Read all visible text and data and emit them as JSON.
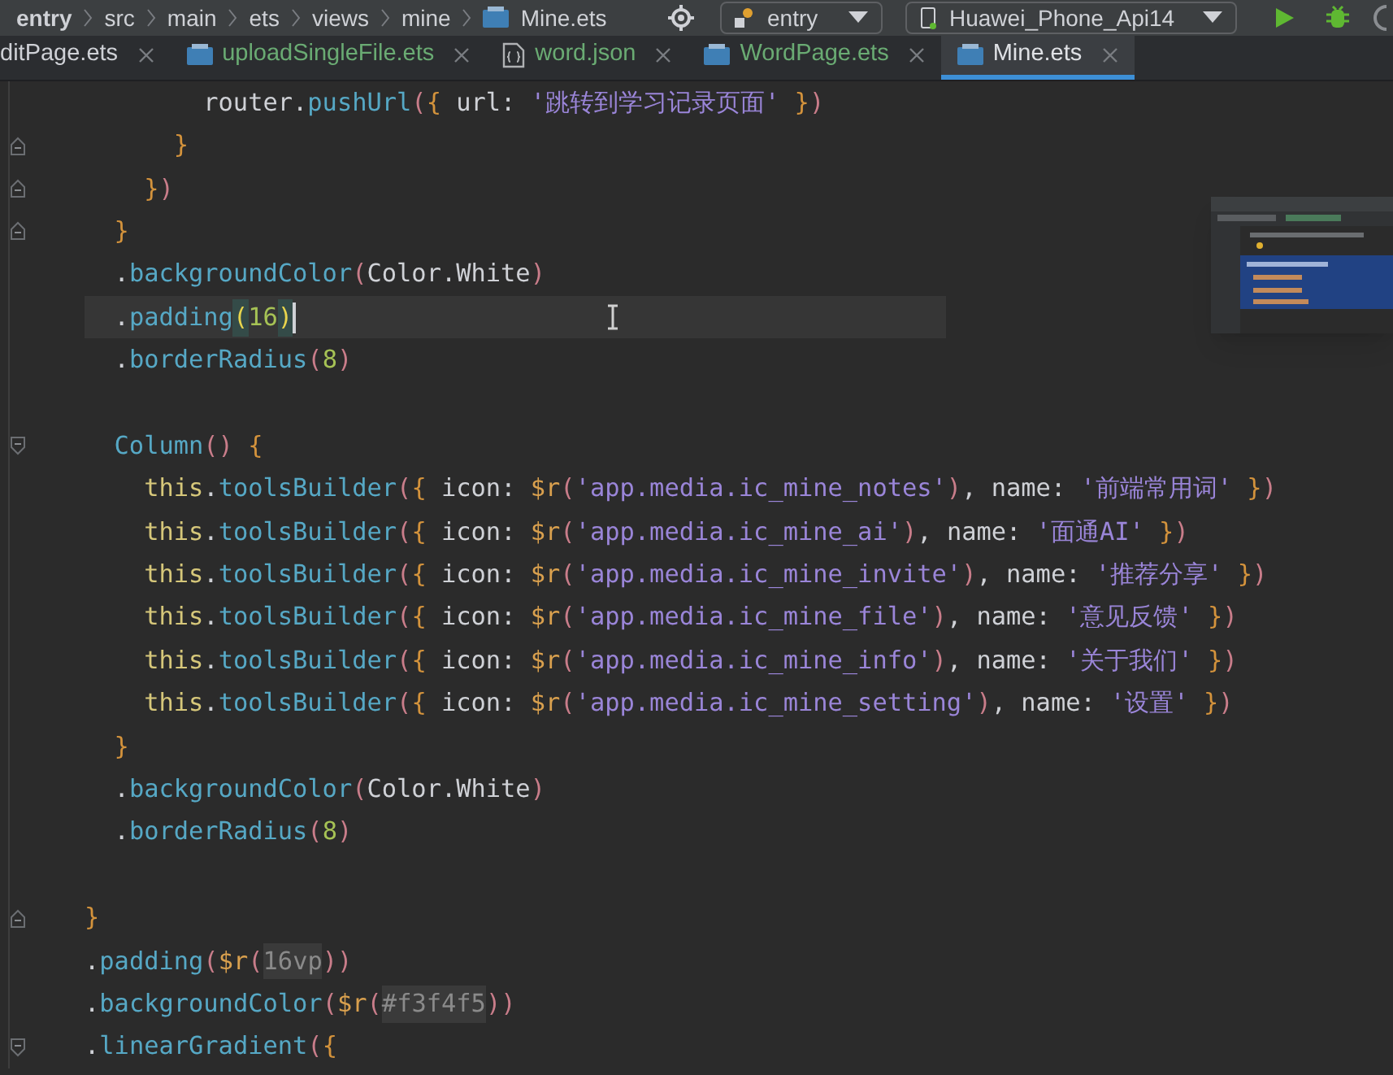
{
  "breadcrumb": [
    {
      "text": "entry",
      "kind": "module"
    },
    {
      "text": "src",
      "kind": "folder"
    },
    {
      "text": "main",
      "kind": "folder"
    },
    {
      "text": "ets",
      "kind": "folder"
    },
    {
      "text": "views",
      "kind": "folder"
    },
    {
      "text": "mine",
      "kind": "folder"
    },
    {
      "text": "Mine.ets",
      "kind": "file"
    }
  ],
  "run_config": {
    "value": "entry"
  },
  "device": {
    "value": "Huawei_Phone_Api14"
  },
  "tabs": [
    {
      "label": "ditPage.ets",
      "kind": "cut",
      "color": "#cfd1d6",
      "selected": false
    },
    {
      "label": "uploadSingleFile.ets",
      "kind": "ets",
      "color": "#6aab73",
      "selected": false
    },
    {
      "label": "word.json",
      "kind": "json",
      "color": "#6aab73",
      "selected": false
    },
    {
      "label": "WordPage.ets",
      "kind": "ets",
      "color": "#6aab73",
      "selected": false
    },
    {
      "label": "Mine.ets",
      "kind": "ets",
      "color": "#dfe1e5",
      "selected": true
    }
  ],
  "lines": [
    {
      "kind": "code",
      "current": false,
      "tokens": [
        {
          "text": "        router.",
          "kind": "code",
          "color": "#cfd1d6"
        },
        {
          "text": "pushUrl",
          "kind": "code",
          "color": "#56a8c5"
        },
        {
          "text": "(",
          "kind": "code",
          "color": "#c97d8a"
        },
        {
          "text": "{",
          "kind": "code",
          "color": "#d4933c"
        },
        {
          "text": " url: ",
          "kind": "code",
          "color": "#cfd1d6"
        },
        {
          "text": "'跳转到学习记录页面' ",
          "kind": "code",
          "color": "#9a85d8"
        },
        {
          "text": "}",
          "kind": "code",
          "color": "#d4933c"
        },
        {
          "text": ")",
          "kind": "code",
          "color": "#c97d8a"
        }
      ]
    },
    {
      "kind": "closer",
      "current": false,
      "tokens": [
        {
          "text": "      }",
          "kind": "code",
          "color": "#d4933c"
        }
      ]
    },
    {
      "kind": "closer",
      "current": false,
      "tokens": [
        {
          "text": "    }",
          "kind": "code",
          "color": "#d4933c"
        },
        {
          "text": ")",
          "kind": "code",
          "color": "#c97d8a"
        }
      ]
    },
    {
      "kind": "closer",
      "current": false,
      "tokens": [
        {
          "text": "  }",
          "kind": "code",
          "color": "#d4933c"
        }
      ]
    },
    {
      "kind": "code",
      "current": false,
      "tokens": [
        {
          "text": "  .",
          "kind": "code",
          "color": "#cfd1d6"
        },
        {
          "text": "backgroundColor",
          "kind": "code",
          "color": "#56a8c5"
        },
        {
          "text": "(",
          "kind": "code",
          "color": "#c97d8a"
        },
        {
          "text": "Color.White",
          "kind": "code",
          "color": "#cfd1d6"
        },
        {
          "text": ")",
          "kind": "code",
          "color": "#c97d8a"
        }
      ]
    },
    {
      "kind": "code",
      "current": true,
      "tokens": [
        {
          "text": "  .",
          "kind": "code",
          "color": "#cfd1d6"
        },
        {
          "text": "padding",
          "kind": "code",
          "color": "#56a8c5"
        },
        {
          "text": "(",
          "kind": "match",
          "color": "#e8d44d"
        },
        {
          "text": "16",
          "kind": "code",
          "color": "#a6c255"
        },
        {
          "text": ")",
          "kind": "match",
          "color": "#e8d44d"
        }
      ]
    },
    {
      "kind": "code",
      "current": false,
      "tokens": [
        {
          "text": "  .",
          "kind": "code",
          "color": "#cfd1d6"
        },
        {
          "text": "borderRadius",
          "kind": "code",
          "color": "#56a8c5"
        },
        {
          "text": "(",
          "kind": "code",
          "color": "#c97d8a"
        },
        {
          "text": "8",
          "kind": "code",
          "color": "#a6c255"
        },
        {
          "text": ")",
          "kind": "code",
          "color": "#c97d8a"
        }
      ]
    },
    {
      "kind": "code",
      "current": false
    },
    {
      "kind": "opener",
      "current": false,
      "tokens": [
        {
          "text": "  Column",
          "kind": "code",
          "color": "#56a8c5"
        },
        {
          "text": "() ",
          "kind": "code",
          "color": "#c97d8a"
        },
        {
          "text": "{",
          "kind": "code",
          "color": "#d4933c"
        }
      ]
    },
    {
      "kind": "code",
      "current": false,
      "tokens": [
        {
          "text": "    this",
          "kind": "code",
          "color": "#d6c77a"
        },
        {
          "text": ".",
          "kind": "code",
          "color": "#cfd1d6"
        },
        {
          "text": "toolsBuilder",
          "kind": "code",
          "color": "#56a8c5"
        },
        {
          "text": "(",
          "kind": "code",
          "color": "#c97d8a"
        },
        {
          "text": "{",
          "kind": "code",
          "color": "#d4933c"
        },
        {
          "text": " icon: ",
          "kind": "code",
          "color": "#cfd1d6"
        },
        {
          "text": "$r",
          "kind": "code",
          "color": "#d9a04e"
        },
        {
          "text": "(",
          "kind": "code",
          "color": "#c97d8a"
        },
        {
          "text": "'app.media.ic_mine_notes'",
          "kind": "code",
          "color": "#9a85d8"
        },
        {
          "text": ")",
          "kind": "code",
          "color": "#c97d8a"
        },
        {
          "text": ", name: ",
          "kind": "code",
          "color": "#cfd1d6"
        },
        {
          "text": "'前端常用词' ",
          "kind": "code",
          "color": "#9a85d8"
        },
        {
          "text": "}",
          "kind": "code",
          "color": "#d4933c"
        },
        {
          "text": ")",
          "kind": "code",
          "color": "#c97d8a"
        }
      ]
    },
    {
      "kind": "code",
      "current": false,
      "tokens": [
        {
          "text": "    this",
          "kind": "code",
          "color": "#d6c77a"
        },
        {
          "text": ".",
          "kind": "code",
          "color": "#cfd1d6"
        },
        {
          "text": "toolsBuilder",
          "kind": "code",
          "color": "#56a8c5"
        },
        {
          "text": "(",
          "kind": "code",
          "color": "#c97d8a"
        },
        {
          "text": "{",
          "kind": "code",
          "color": "#d4933c"
        },
        {
          "text": " icon: ",
          "kind": "code",
          "color": "#cfd1d6"
        },
        {
          "text": "$r",
          "kind": "code",
          "color": "#d9a04e"
        },
        {
          "text": "(",
          "kind": "code",
          "color": "#c97d8a"
        },
        {
          "text": "'app.media.ic_mine_ai'",
          "kind": "code",
          "color": "#9a85d8"
        },
        {
          "text": ")",
          "kind": "code",
          "color": "#c97d8a"
        },
        {
          "text": ", name: ",
          "kind": "code",
          "color": "#cfd1d6"
        },
        {
          "text": "'面通AI' ",
          "kind": "code",
          "color": "#9a85d8"
        },
        {
          "text": "}",
          "kind": "code",
          "color": "#d4933c"
        },
        {
          "text": ")",
          "kind": "code",
          "color": "#c97d8a"
        }
      ]
    },
    {
      "kind": "code",
      "current": false,
      "tokens": [
        {
          "text": "    this",
          "kind": "code",
          "color": "#d6c77a"
        },
        {
          "text": ".",
          "kind": "code",
          "color": "#cfd1d6"
        },
        {
          "text": "toolsBuilder",
          "kind": "code",
          "color": "#56a8c5"
        },
        {
          "text": "(",
          "kind": "code",
          "color": "#c97d8a"
        },
        {
          "text": "{",
          "kind": "code",
          "color": "#d4933c"
        },
        {
          "text": " icon: ",
          "kind": "code",
          "color": "#cfd1d6"
        },
        {
          "text": "$r",
          "kind": "code",
          "color": "#d9a04e"
        },
        {
          "text": "(",
          "kind": "code",
          "color": "#c97d8a"
        },
        {
          "text": "'app.media.ic_mine_invite'",
          "kind": "code",
          "color": "#9a85d8"
        },
        {
          "text": ")",
          "kind": "code",
          "color": "#c97d8a"
        },
        {
          "text": ", name: ",
          "kind": "code",
          "color": "#cfd1d6"
        },
        {
          "text": "'推荐分享' ",
          "kind": "code",
          "color": "#9a85d8"
        },
        {
          "text": "}",
          "kind": "code",
          "color": "#d4933c"
        },
        {
          "text": ")",
          "kind": "code",
          "color": "#c97d8a"
        }
      ]
    },
    {
      "kind": "code",
      "current": false,
      "tokens": [
        {
          "text": "    this",
          "kind": "code",
          "color": "#d6c77a"
        },
        {
          "text": ".",
          "kind": "code",
          "color": "#cfd1d6"
        },
        {
          "text": "toolsBuilder",
          "kind": "code",
          "color": "#56a8c5"
        },
        {
          "text": "(",
          "kind": "code",
          "color": "#c97d8a"
        },
        {
          "text": "{",
          "kind": "code",
          "color": "#d4933c"
        },
        {
          "text": " icon: ",
          "kind": "code",
          "color": "#cfd1d6"
        },
        {
          "text": "$r",
          "kind": "code",
          "color": "#d9a04e"
        },
        {
          "text": "(",
          "kind": "code",
          "color": "#c97d8a"
        },
        {
          "text": "'app.media.ic_mine_file'",
          "kind": "code",
          "color": "#9a85d8"
        },
        {
          "text": ")",
          "kind": "code",
          "color": "#c97d8a"
        },
        {
          "text": ", name: ",
          "kind": "code",
          "color": "#cfd1d6"
        },
        {
          "text": "'意见反馈' ",
          "kind": "code",
          "color": "#9a85d8"
        },
        {
          "text": "}",
          "kind": "code",
          "color": "#d4933c"
        },
        {
          "text": ")",
          "kind": "code",
          "color": "#c97d8a"
        }
      ]
    },
    {
      "kind": "code",
      "current": false,
      "tokens": [
        {
          "text": "    this",
          "kind": "code",
          "color": "#d6c77a"
        },
        {
          "text": ".",
          "kind": "code",
          "color": "#cfd1d6"
        },
        {
          "text": "toolsBuilder",
          "kind": "code",
          "color": "#56a8c5"
        },
        {
          "text": "(",
          "kind": "code",
          "color": "#c97d8a"
        },
        {
          "text": "{",
          "kind": "code",
          "color": "#d4933c"
        },
        {
          "text": " icon: ",
          "kind": "code",
          "color": "#cfd1d6"
        },
        {
          "text": "$r",
          "kind": "code",
          "color": "#d9a04e"
        },
        {
          "text": "(",
          "kind": "code",
          "color": "#c97d8a"
        },
        {
          "text": "'app.media.ic_mine_info'",
          "kind": "code",
          "color": "#9a85d8"
        },
        {
          "text": ")",
          "kind": "code",
          "color": "#c97d8a"
        },
        {
          "text": ", name: ",
          "kind": "code",
          "color": "#cfd1d6"
        },
        {
          "text": "'关于我们' ",
          "kind": "code",
          "color": "#9a85d8"
        },
        {
          "text": "}",
          "kind": "code",
          "color": "#d4933c"
        },
        {
          "text": ")",
          "kind": "code",
          "color": "#c97d8a"
        }
      ]
    },
    {
      "kind": "code",
      "current": false,
      "tokens": [
        {
          "text": "    this",
          "kind": "code",
          "color": "#d6c77a"
        },
        {
          "text": ".",
          "kind": "code",
          "color": "#cfd1d6"
        },
        {
          "text": "toolsBuilder",
          "kind": "code",
          "color": "#56a8c5"
        },
        {
          "text": "(",
          "kind": "code",
          "color": "#c97d8a"
        },
        {
          "text": "{",
          "kind": "code",
          "color": "#d4933c"
        },
        {
          "text": " icon: ",
          "kind": "code",
          "color": "#cfd1d6"
        },
        {
          "text": "$r",
          "kind": "code",
          "color": "#d9a04e"
        },
        {
          "text": "(",
          "kind": "code",
          "color": "#c97d8a"
        },
        {
          "text": "'app.media.ic_mine_setting'",
          "kind": "code",
          "color": "#9a85d8"
        },
        {
          "text": ")",
          "kind": "code",
          "color": "#c97d8a"
        },
        {
          "text": ", name: ",
          "kind": "code",
          "color": "#cfd1d6"
        },
        {
          "text": "'设置' ",
          "kind": "code",
          "color": "#9a85d8"
        },
        {
          "text": "}",
          "kind": "code",
          "color": "#d4933c"
        },
        {
          "text": ")",
          "kind": "code",
          "color": "#c97d8a"
        }
      ]
    },
    {
      "kind": "code",
      "current": false,
      "tokens": [
        {
          "text": "  }",
          "kind": "code",
          "color": "#d4933c"
        }
      ]
    },
    {
      "kind": "code",
      "current": false,
      "tokens": [
        {
          "text": "  .",
          "kind": "code",
          "color": "#cfd1d6"
        },
        {
          "text": "backgroundColor",
          "kind": "code",
          "color": "#56a8c5"
        },
        {
          "text": "(",
          "kind": "code",
          "color": "#c97d8a"
        },
        {
          "text": "Color.White",
          "kind": "code",
          "color": "#cfd1d6"
        },
        {
          "text": ")",
          "kind": "code",
          "color": "#c97d8a"
        }
      ]
    },
    {
      "kind": "code",
      "current": false,
      "tokens": [
        {
          "text": "  .",
          "kind": "code",
          "color": "#cfd1d6"
        },
        {
          "text": "borderRadius",
          "kind": "code",
          "color": "#56a8c5"
        },
        {
          "text": "(",
          "kind": "code",
          "color": "#c97d8a"
        },
        {
          "text": "8",
          "kind": "code",
          "color": "#a6c255"
        },
        {
          "text": ")",
          "kind": "code",
          "color": "#c97d8a"
        }
      ]
    },
    {
      "kind": "code",
      "current": false
    },
    {
      "kind": "closer",
      "current": false,
      "tokens": [
        {
          "text": "}",
          "kind": "code",
          "color": "#d4933c"
        }
      ]
    },
    {
      "kind": "code",
      "current": false,
      "tokens": [
        {
          "text": ".",
          "kind": "code",
          "color": "#cfd1d6"
        },
        {
          "text": "padding",
          "kind": "code",
          "color": "#56a8c5"
        },
        {
          "text": "(",
          "kind": "code",
          "color": "#c97d8a"
        },
        {
          "text": "$r",
          "kind": "code",
          "color": "#d9a04e"
        },
        {
          "text": "(",
          "kind": "code",
          "color": "#c97d8a"
        },
        {
          "text": "16vp",
          "kind": "hint",
          "color": "#8a8a8a"
        },
        {
          "text": "))",
          "kind": "code",
          "color": "#c97d8a"
        }
      ]
    },
    {
      "kind": "code",
      "current": false,
      "tokens": [
        {
          "text": ".",
          "kind": "code",
          "color": "#cfd1d6"
        },
        {
          "text": "backgroundColor",
          "kind": "code",
          "color": "#56a8c5"
        },
        {
          "text": "(",
          "kind": "code",
          "color": "#c97d8a"
        },
        {
          "text": "$r",
          "kind": "code",
          "color": "#d9a04e"
        },
        {
          "text": "(",
          "kind": "code",
          "color": "#c97d8a"
        },
        {
          "text": "#f3f4f5",
          "kind": "hint",
          "color": "#8a8a8a"
        },
        {
          "text": "))",
          "kind": "code",
          "color": "#c97d8a"
        }
      ]
    },
    {
      "kind": "opener",
      "current": false,
      "tokens": [
        {
          "text": ".",
          "kind": "code",
          "color": "#cfd1d6"
        },
        {
          "text": "linearGradient",
          "kind": "code",
          "color": "#56a8c5"
        },
        {
          "text": "(",
          "kind": "code",
          "color": "#c97d8a"
        },
        {
          "text": "{",
          "kind": "code",
          "color": "#d4933c"
        }
      ]
    }
  ]
}
